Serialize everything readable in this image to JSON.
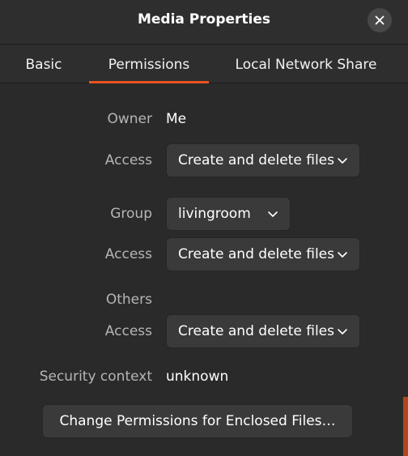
{
  "window": {
    "title": "Media Properties"
  },
  "tabs": [
    {
      "label": "Basic",
      "active": false
    },
    {
      "label": "Permissions",
      "active": true
    },
    {
      "label": "Local Network Share",
      "active": false
    }
  ],
  "owner": {
    "label": "Owner",
    "value": "Me",
    "access_label": "Access",
    "access_value": "Create and delete files"
  },
  "group": {
    "label": "Group",
    "value": "livingroom",
    "access_label": "Access",
    "access_value": "Create and delete files"
  },
  "others": {
    "label": "Others",
    "access_label": "Access",
    "access_value": "Create and delete files"
  },
  "security": {
    "label": "Security context",
    "value": "unknown"
  },
  "enclosed_button": {
    "label": "Change Permissions for Enclosed Files…"
  },
  "colors": {
    "accent": "#e95420",
    "background": "#2a2a2a",
    "control": "#3a3a3a"
  },
  "icons": {
    "close": "close-icon",
    "dropdown": "chevron-down-icon"
  }
}
